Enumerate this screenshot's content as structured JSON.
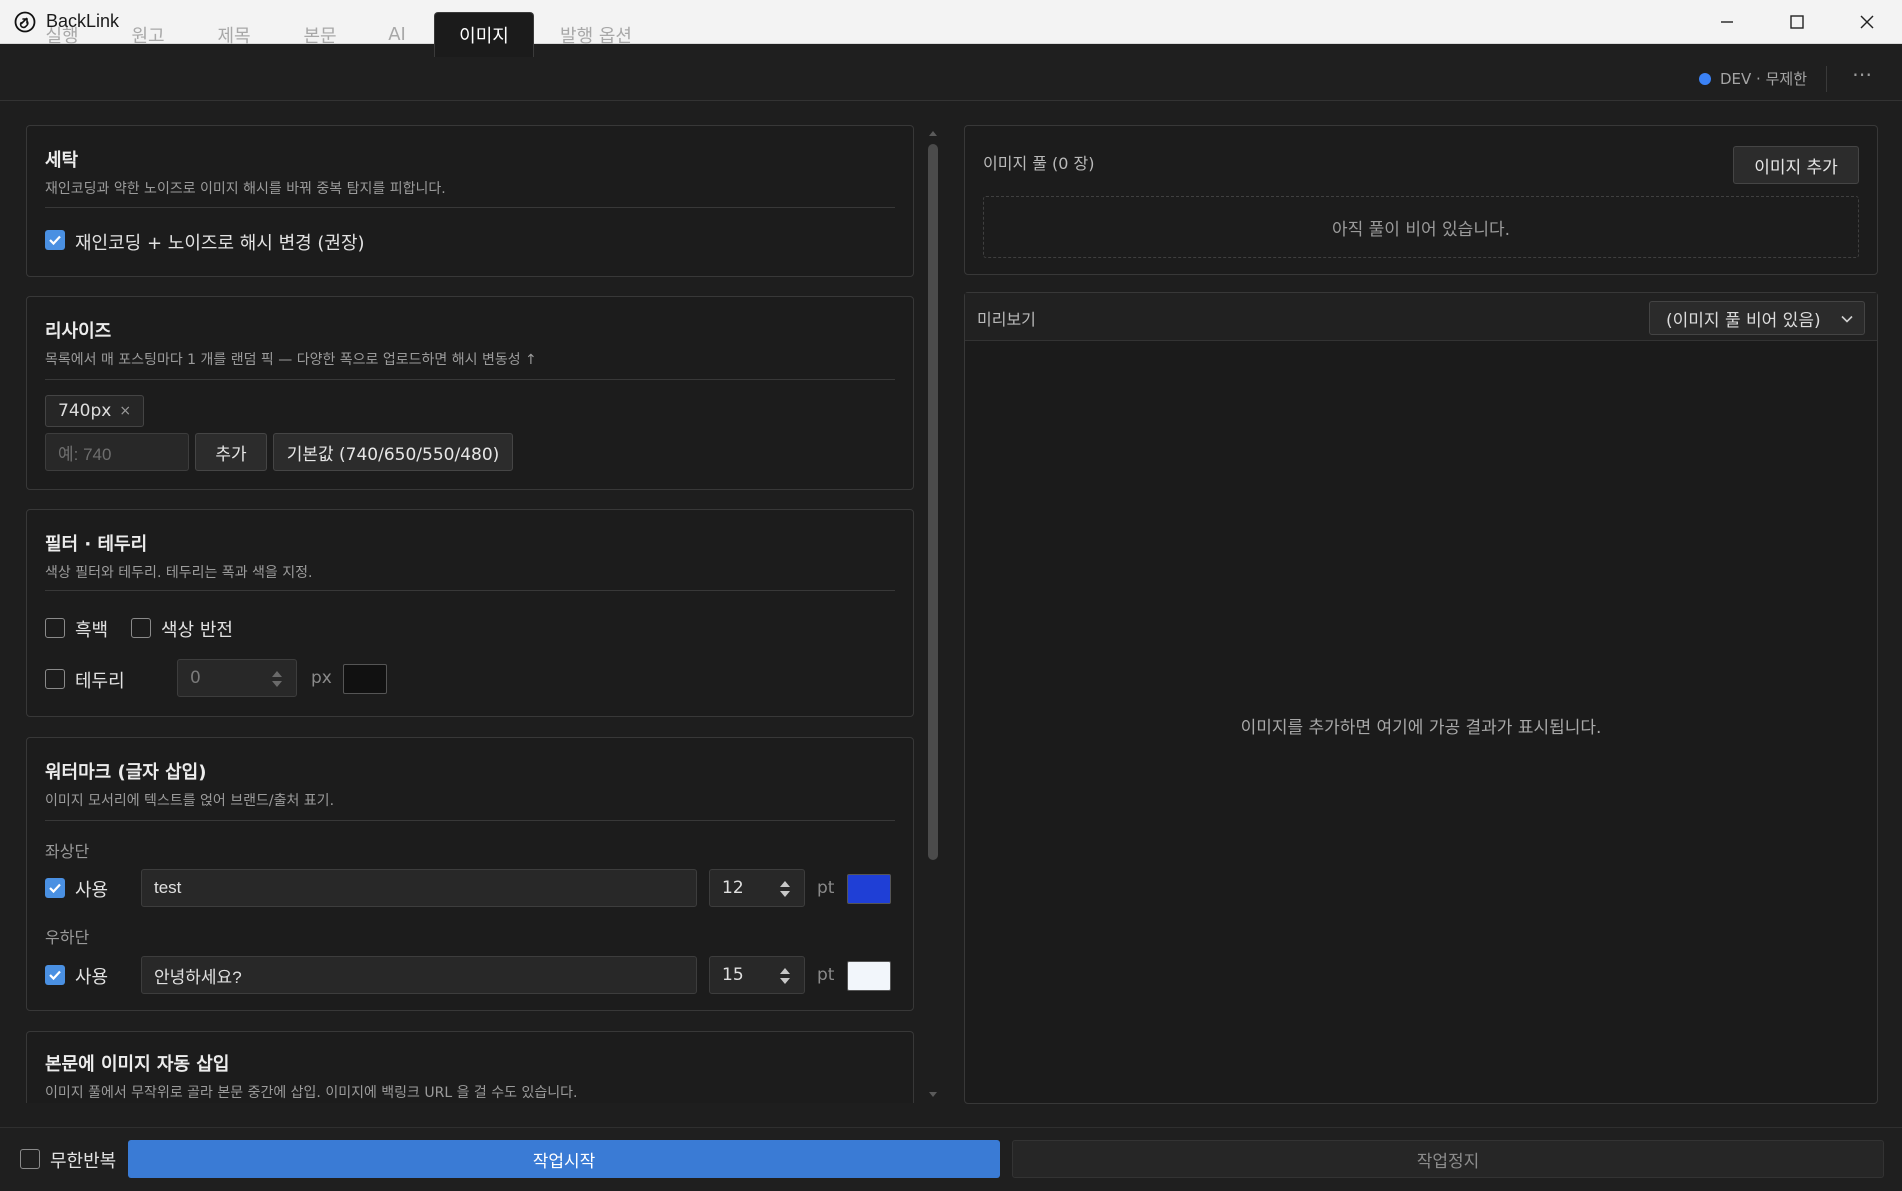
{
  "window": {
    "title": "BackLink"
  },
  "tabs": [
    {
      "label": "실행"
    },
    {
      "label": "원고"
    },
    {
      "label": "제목"
    },
    {
      "label": "본문"
    },
    {
      "label": "AI"
    },
    {
      "label": "이미지"
    },
    {
      "label": "발행 옵션"
    }
  ],
  "active_tab": "이미지",
  "status": {
    "text": "DEV · 무제한",
    "dot_color": "#3b82f6"
  },
  "sections": {
    "wash": {
      "title": "세탁",
      "desc": "재인코딩과 약한 노이즈로 이미지 해시를 바꿔 중복 탐지를 피합니다.",
      "checkbox_label": "재인코딩 + 노이즈로 해시 변경 (권장)",
      "checked": true
    },
    "resize": {
      "title": "리사이즈",
      "desc": "목록에서 매 포스팅마다 1 개를 랜덤 픽 — 다양한 폭으로 업로드하면 해시 변동성 ↑",
      "chips": [
        {
          "label": "740px",
          "remove": "×"
        }
      ],
      "input_placeholder": "예: 740",
      "add_label": "추가",
      "default_label": "기본값 (740/650/550/480)"
    },
    "filter": {
      "title": "필터 · 테두리",
      "desc": "색상 필터와 테두리. 테두리는 폭과 색을 지정.",
      "grayscale_label": "흑백",
      "grayscale": false,
      "invert_label": "색상 반전",
      "invert": false,
      "border_label": "테두리",
      "border": false,
      "border_width": "0",
      "border_unit": "px",
      "border_color": "#111111"
    },
    "watermark": {
      "title": "워터마크 (글자 삽입)",
      "desc": "이미지 모서리에 텍스트를 얹어 브랜드/출처 표기.",
      "top_left": {
        "heading": "좌상단",
        "use_label": "사용",
        "enabled": true,
        "text": "test",
        "size": "12",
        "unit": "pt",
        "color": "#1f3fd6"
      },
      "bottom_right": {
        "heading": "우하단",
        "use_label": "사용",
        "enabled": true,
        "text": "안녕하세요?",
        "size": "15",
        "unit": "pt",
        "color": "#f2f6fb"
      }
    },
    "autoinsert": {
      "title": "본문에 이미지 자동 삽입",
      "desc": "이미지 풀에서 무작위로 골라 본문 중간에 삽입. 이미지에 백링크 URL 을 걸 수도 있습니다."
    }
  },
  "pool": {
    "title": "이미지 풀 (0 장)",
    "add_label": "이미지 추가",
    "empty_text": "아직 풀이 비어 있습니다."
  },
  "preview": {
    "label": "미리보기",
    "select_value": "(이미지 풀 비어 있음)",
    "empty_text": "이미지를 추가하면 여기에 가공 결과가 표시됩니다."
  },
  "bottom": {
    "loop_label": "무한반복",
    "loop": false,
    "start_label": "작업시작",
    "stop_label": "작업정지"
  }
}
